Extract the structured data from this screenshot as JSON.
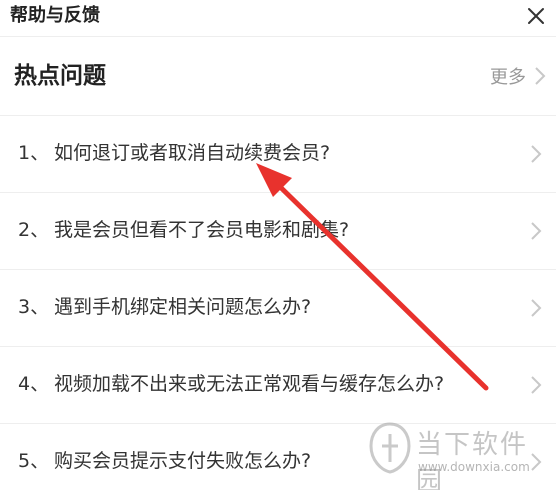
{
  "window": {
    "title": "帮助与反馈",
    "close_icon": "close-icon"
  },
  "hot_section": {
    "title": "热点问题",
    "more_label": "更多",
    "more_icon": "chevron-right-icon"
  },
  "questions": [
    {
      "num": "1、",
      "text": "如何退订或者取消自动续费会员?"
    },
    {
      "num": "2、",
      "text": "我是会员但看不了会员电影和剧集?"
    },
    {
      "num": "3、",
      "text": "遇到手机绑定相关问题怎么办?"
    },
    {
      "num": "4、",
      "text": "视频加载不出来或无法正常观看与缓存怎么办?"
    },
    {
      "num": "5、",
      "text": "购买会员提示支付失败怎么办?"
    }
  ],
  "annotation": {
    "type": "arrow",
    "color": "#e8322d",
    "points_to": "1、如何退订或者取消自动续费会员?"
  },
  "watermark": {
    "name": "当下软件园",
    "url": "www.downxia.com"
  },
  "colors": {
    "text_primary": "#222222",
    "text_secondary": "#999999",
    "divider": "#eeeeee",
    "chevron": "#c8c8c8"
  }
}
